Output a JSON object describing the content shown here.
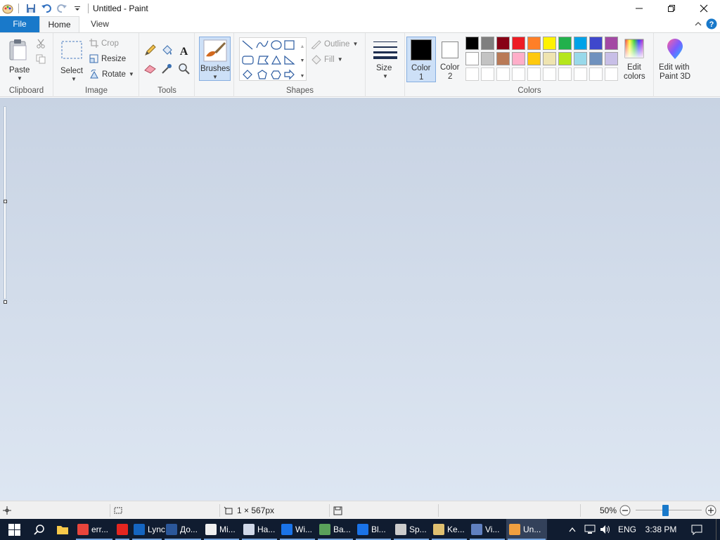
{
  "titlebar": {
    "title": "Untitled - Paint",
    "quick_access": [
      "paint-app-icon",
      "save-icon",
      "undo-icon",
      "redo-icon",
      "customize-qa-icon"
    ]
  },
  "tabs": {
    "file": "File",
    "home": "Home",
    "view": "View"
  },
  "ribbon": {
    "clipboard": {
      "label": "Clipboard",
      "paste": "Paste"
    },
    "image": {
      "label": "Image",
      "select": "Select",
      "crop": "Crop",
      "resize": "Resize",
      "rotate": "Rotate"
    },
    "tools": {
      "label": "Tools"
    },
    "brushes": {
      "label": "Brushes"
    },
    "shapes": {
      "label": "Shapes",
      "outline": "Outline",
      "fill": "Fill"
    },
    "size": {
      "label": "Size"
    },
    "colors": {
      "label": "Colors",
      "color1": "Color",
      "color1_num": "1",
      "color2": "Color",
      "color2_num": "2",
      "color1_value": "#000000",
      "color2_value": "#ffffff",
      "edit_colors_1": "Edit",
      "edit_colors_2": "colors",
      "row1": [
        "#000000",
        "#7f7f7f",
        "#880015",
        "#ed1c24",
        "#ff7f27",
        "#fff200",
        "#22b14c",
        "#00a2e8",
        "#3f48cc",
        "#a349a4"
      ],
      "row2": [
        "#ffffff",
        "#c3c3c3",
        "#b97a57",
        "#ffaec9",
        "#ffc90e",
        "#efe4b0",
        "#b5e61d",
        "#99d9ea",
        "#7092be",
        "#c8bfe7"
      ]
    },
    "paint3d": {
      "line1": "Edit with",
      "line2": "Paint 3D"
    }
  },
  "statusbar": {
    "image_size": "1 × 567px",
    "zoom": "50%",
    "zoom_fraction": 0.45
  },
  "taskbar": {
    "items": [
      {
        "label": "err...",
        "icon": "chrome-icon",
        "color": "#e8453c"
      },
      {
        "label": "",
        "icon": "yandex-browser-icon",
        "color": "#e52620"
      },
      {
        "label": "Lync",
        "icon": "lync-icon",
        "color": "#1565c0"
      },
      {
        "label": "До...",
        "icon": "word-icon",
        "color": "#2b579a"
      },
      {
        "label": "Mi...",
        "icon": "app-icon",
        "color": "#f0f0f0"
      },
      {
        "label": "На...",
        "icon": "window-app-icon",
        "color": "#d0d8e8"
      },
      {
        "label": "Wi...",
        "icon": "outlook-icon",
        "color": "#1a73e8"
      },
      {
        "label": "Ba...",
        "icon": "network-app-icon",
        "color": "#5aa15a"
      },
      {
        "label": "Bl...",
        "icon": "bluetooth-icon",
        "color": "#1a73e8"
      },
      {
        "label": "Sp...",
        "icon": "microphone-icon",
        "color": "#cccccc"
      },
      {
        "label": "Ke...",
        "icon": "keyboard-app-icon",
        "color": "#e0c070"
      },
      {
        "label": "Vi...",
        "icon": "vpn-app-icon",
        "color": "#6080c0"
      },
      {
        "label": "Un...",
        "icon": "paint-icon",
        "color": "#f0a040"
      }
    ],
    "lang": "ENG",
    "time": "3:38 PM"
  }
}
